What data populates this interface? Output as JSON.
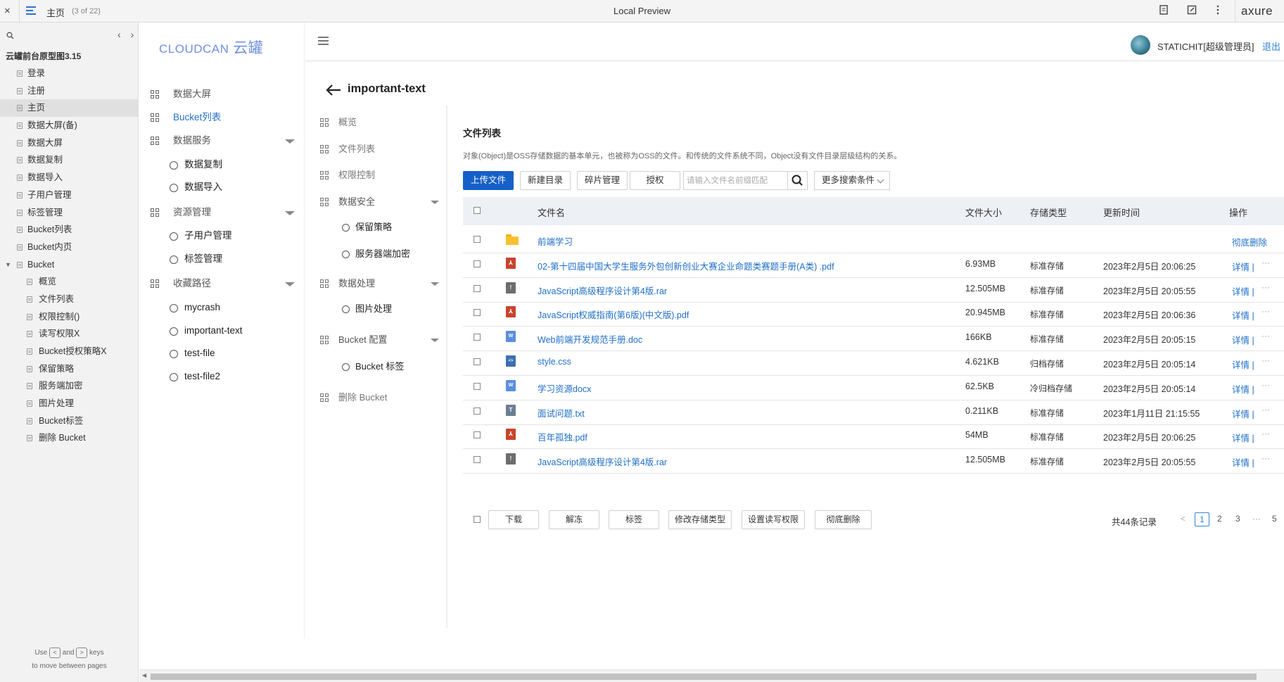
{
  "axure": {
    "close": "×",
    "page_name": "主页",
    "page_count": "(3 of 22)",
    "preview_title": "Local Preview",
    "brand": "axure",
    "project": "云罐前台原型图3.15",
    "hint_line1_pre": "Use",
    "hint_key_prev": "<",
    "hint_and": "and",
    "hint_key_next": ">",
    "hint_line1_post": "keys",
    "hint_line2": "to move between pages",
    "pages": [
      {
        "label": "登录",
        "level": 1
      },
      {
        "label": "注册",
        "level": 1
      },
      {
        "label": "主页",
        "level": 1,
        "active": true
      },
      {
        "label": "数据大屏(备)",
        "level": 1
      },
      {
        "label": "数据大屏",
        "level": 1
      },
      {
        "label": "数据复制",
        "level": 1
      },
      {
        "label": "数据导入",
        "level": 1
      },
      {
        "label": "子用户管理",
        "level": 1
      },
      {
        "label": "标签管理",
        "level": 1
      },
      {
        "label": "Bucket列表",
        "level": 1
      },
      {
        "label": "Bucket内页",
        "level": 1
      },
      {
        "label": "Bucket",
        "level": 1,
        "folder": true
      },
      {
        "label": "概览",
        "level": 2
      },
      {
        "label": "文件列表",
        "level": 2
      },
      {
        "label": "权限控制()",
        "level": 2
      },
      {
        "label": "读写权限X",
        "level": 2
      },
      {
        "label": "Bucket授权策略X",
        "level": 2
      },
      {
        "label": "保留策略",
        "level": 2
      },
      {
        "label": "服务端加密",
        "level": 2
      },
      {
        "label": "图片处理",
        "level": 2
      },
      {
        "label": "Bucket标签",
        "level": 2
      },
      {
        "label": "删除 Bucket",
        "level": 2
      }
    ]
  },
  "app": {
    "logo_en": "CLOUDCAN",
    "logo_cn": "云罐",
    "user_name": "STATICHIT[超级管理员]",
    "logout": "退出",
    "nav": {
      "screen": "数据大屏",
      "bucket_list": "Bucket列表",
      "data_service": "数据服务",
      "data_copy": "数据复制",
      "data_import": "数据导入",
      "resource_mgmt": "资源管理",
      "sub_user": "子用户管理",
      "tag_mgmt": "标签管理",
      "favorites": "收藏路径",
      "fav1": "mycrash",
      "fav2": "important-text",
      "fav3": "test-file",
      "fav4": "test-file2"
    },
    "bucket_name": "important-text",
    "secnav": {
      "overview": "概览",
      "file_list": "文件列表",
      "permission": "权限控制",
      "data_security": "数据安全",
      "retention": "保留策略",
      "encryption": "服务器端加密",
      "data_processing": "数据处理",
      "image_processing": "图片处理",
      "bucket_config": "Bucket 配置",
      "bucket_tag": "Bucket 标签",
      "delete_bucket": "删除 Bucket"
    },
    "main": {
      "title": "文件列表",
      "desc": "对象(Object)是OSS存储数据的基本单元，也被称为OSS的文件。和传统的文件系统不同，Object没有文件目录层级结构的关系。",
      "upload": "上传文件",
      "new_dir": "新建目录",
      "fragments": "碎片管理",
      "authorize": "授权",
      "search_placeholder": "请输入文件名前缀匹配",
      "more_search": "更多搜索条件",
      "columns": {
        "name": "文件名",
        "size": "文件大小",
        "storage": "存储类型",
        "updated": "更新时间",
        "ops": "操作"
      },
      "rows": [
        {
          "icon": "folder",
          "name": "前端学习",
          "size": "",
          "storage": "",
          "updated": "",
          "action": "彻底删除",
          "more": ""
        },
        {
          "icon": "pdf",
          "name": "02-第十四届中国大学生服务外包创新创业大赛企业命题类赛题手册(A类) .pdf",
          "size": "6.93MB",
          "storage": "标准存储",
          "updated": "2023年2月5日 20:06:25",
          "action": "详情 |",
          "more": "···"
        },
        {
          "icon": "rar",
          "name": "JavaScript高级程序设计第4版.rar",
          "size": "12.505MB",
          "storage": "标准存储",
          "updated": "2023年2月5日 20:05:55",
          "action": "详情 |",
          "more": "···"
        },
        {
          "icon": "pdf",
          "name": "JavaScript权威指南(第6版)(中文版).pdf",
          "size": "20.945MB",
          "storage": "标准存储",
          "updated": "2023年2月5日 20:06:36",
          "action": "详情 |",
          "more": "···"
        },
        {
          "icon": "doc",
          "name": "Web前端开发规范手册.doc",
          "size": "166KB",
          "storage": "标准存储",
          "updated": "2023年2月5日 20:05:15",
          "action": "详情 |",
          "more": "···"
        },
        {
          "icon": "css",
          "name": "style.css",
          "size": "4.621KB",
          "storage": "归档存储",
          "updated": "2023年2月5日 20:05:14",
          "action": "详情 |",
          "more": "···"
        },
        {
          "icon": "doc",
          "name": "学习资源docx",
          "size": "62.5KB",
          "storage": "冷归档存储",
          "updated": "2023年2月5日 20:05:14",
          "action": "详情 |",
          "more": "···"
        },
        {
          "icon": "txt",
          "name": "面试问题.txt",
          "size": "0.211KB",
          "storage": "标准存储",
          "updated": "2023年1月11日 21:15:55",
          "action": "详情 |",
          "more": "···"
        },
        {
          "icon": "pdf",
          "name": "百年孤独.pdf",
          "size": "54MB",
          "storage": "标准存储",
          "updated": "2023年2月5日 20:06:25",
          "action": "详情 |",
          "more": "···"
        },
        {
          "icon": "rar",
          "name": "JavaScript高级程序设计第4版.rar",
          "size": "12.505MB",
          "storage": "标准存储",
          "updated": "2023年2月5日 20:05:55",
          "action": "详情 |",
          "more": "···"
        }
      ],
      "footer": {
        "download": "下载",
        "unfreeze": "解冻",
        "tag": "标签",
        "change_storage": "修改存储类型",
        "set_acl": "设置读写权限",
        "delete_all": "彻底删除",
        "total": "共44条记录",
        "prev": "<",
        "pages": [
          "1",
          "2",
          "3",
          "···",
          "5"
        ],
        "current_page": "1"
      }
    }
  }
}
